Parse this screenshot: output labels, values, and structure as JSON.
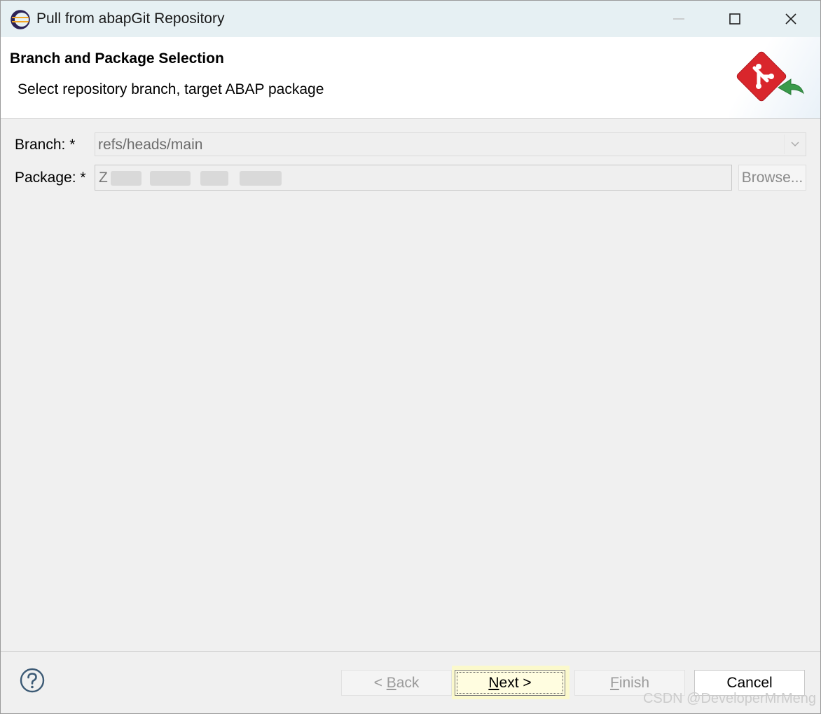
{
  "window": {
    "title": "Pull from abapGit Repository"
  },
  "banner": {
    "title": "Branch and Package Selection",
    "subtitle": "Select repository branch, target ABAP package"
  },
  "form": {
    "branch_label": "Branch: *",
    "branch_value": "refs/heads/main",
    "package_label": "Package: *",
    "package_value": "Z",
    "browse_label": "Browse..."
  },
  "buttons": {
    "back_prefix": "< ",
    "back_mnemonic": "B",
    "back_rest": "ack",
    "next_mnemonic": "N",
    "next_rest": "ext >",
    "finish_mnemonic": "F",
    "finish_rest": "inish",
    "cancel": "Cancel"
  },
  "watermark": "CSDN @DeveloperMrMeng",
  "colors": {
    "titlebar": "#e6f0f3",
    "next_highlight": "#fbf9cc",
    "git_red": "#d9262c",
    "arrow_green": "#3a9a4a"
  },
  "icons": {
    "app": "eclipse-icon",
    "banner": "git-pull-icon",
    "help": "help-icon"
  }
}
